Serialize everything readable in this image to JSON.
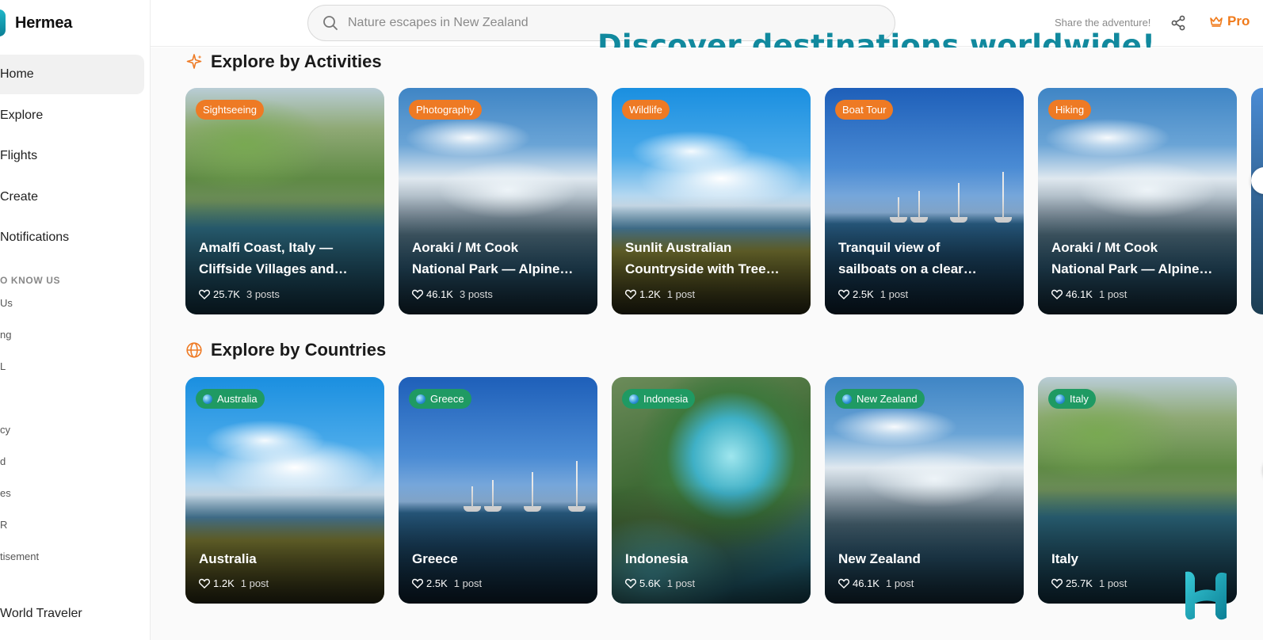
{
  "app": {
    "name": "Hermea"
  },
  "sidebar": {
    "nav": [
      {
        "label": "Home",
        "active": true
      },
      {
        "label": "Explore"
      },
      {
        "label": "Flights"
      },
      {
        "label": "Create"
      },
      {
        "label": "Notifications"
      }
    ],
    "section_label": "O KNOW US",
    "links": [
      "Us",
      "ng",
      "L",
      "",
      "cy",
      "d",
      "es",
      "R",
      "tisement"
    ],
    "profile": "World Traveler"
  },
  "header": {
    "search_placeholder": "Nature escapes in New Zealand",
    "share_text": "Share the adventure!",
    "pro_label": "Pro"
  },
  "promo_text": "Discover destinations worldwide!",
  "activities": {
    "title": "Explore by Activities",
    "cards": [
      {
        "tag": "Sightseeing",
        "title_1": "Amalfi Coast, Italy —",
        "title_2": "Cliffside Villages and…",
        "likes": "25.7K",
        "posts": "3 posts",
        "scene": "amalfi"
      },
      {
        "tag": "Photography",
        "title_1": "Aoraki / Mt Cook",
        "title_2": "National Park — Alpine…",
        "likes": "46.1K",
        "posts": "3 posts",
        "scene": "cook"
      },
      {
        "tag": "Wildlife",
        "title_1": "Sunlit Australian",
        "title_2": "Countryside with Tree…",
        "likes": "1.2K",
        "posts": "1 post",
        "scene": "aus"
      },
      {
        "tag": "Boat Tour",
        "title_1": "Tranquil view of",
        "title_2": "sailboats on a clear…",
        "likes": "2.5K",
        "posts": "1 post",
        "scene": "boat"
      },
      {
        "tag": "Hiking",
        "title_1": "Aoraki / Mt Cook",
        "title_2": "National Park — Alpine…",
        "likes": "46.1K",
        "posts": "1 post",
        "scene": "cook"
      }
    ]
  },
  "countries": {
    "title": "Explore by Countries",
    "cards": [
      {
        "tag": "Australia",
        "title": "Australia",
        "likes": "1.2K",
        "posts": "1 post",
        "scene": "aus"
      },
      {
        "tag": "Greece",
        "title": "Greece",
        "likes": "2.5K",
        "posts": "1 post",
        "scene": "boat"
      },
      {
        "tag": "Indonesia",
        "title": "Indonesia",
        "likes": "5.6K",
        "posts": "1 post",
        "scene": "indo"
      },
      {
        "tag": "New Zealand",
        "title": "New Zealand",
        "likes": "46.1K",
        "posts": "1 post",
        "scene": "cook"
      },
      {
        "tag": "Italy",
        "title": "Italy",
        "likes": "25.7K",
        "posts": "1 post",
        "scene": "amalfi"
      }
    ]
  },
  "colors": {
    "accent_orange": "#ee7a24",
    "accent_teal": "#11899e",
    "country_tag_green": "#1f9a63"
  }
}
